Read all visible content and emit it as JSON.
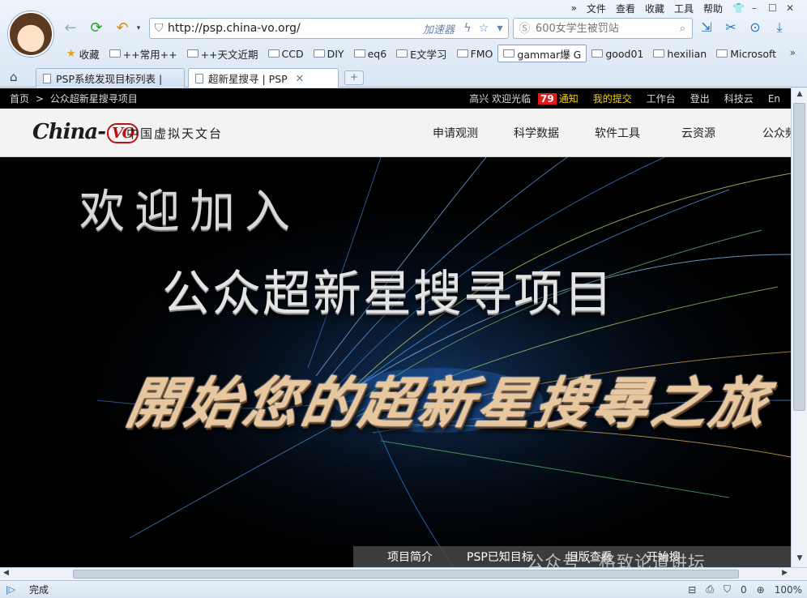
{
  "browser": {
    "menu": [
      "文件",
      "查看",
      "收藏",
      "工具",
      "帮助"
    ],
    "address_url": "http://psp.china-vo.org/",
    "accelerator_label": "加速器",
    "search_placeholder": "600女学生被罚站",
    "bookmarks": [
      {
        "label": "收藏",
        "type": "star"
      },
      {
        "label": "++常用++",
        "type": "folder"
      },
      {
        "label": "++天文近期",
        "type": "folder"
      },
      {
        "label": "CCD",
        "type": "folder"
      },
      {
        "label": "DIY",
        "type": "folder"
      },
      {
        "label": "eq6",
        "type": "folder"
      },
      {
        "label": "E文学习",
        "type": "folder"
      },
      {
        "label": "FMO",
        "type": "folder"
      },
      {
        "label": "gammar爆 G",
        "type": "folder",
        "active": true
      },
      {
        "label": "good01",
        "type": "folder"
      },
      {
        "label": "hexilian",
        "type": "folder"
      },
      {
        "label": "Microsoft",
        "type": "folder"
      }
    ],
    "tabs": [
      {
        "label": "PSP系统发现目标列表 | ",
        "active": false
      },
      {
        "label": "超新星搜寻 | PSP",
        "active": true
      }
    ]
  },
  "page": {
    "breadcrumb": {
      "home": "首页",
      "sep": ">",
      "current": "公众超新星搜寻项目"
    },
    "topbar_right": {
      "welcome": "高兴 欢迎光临",
      "notice_count": "79",
      "notice_label": "通知",
      "my_submissions": "我的提交",
      "workbench": "工作台",
      "logout": "登出",
      "kejiyun": "科技云",
      "lang": "En"
    },
    "logo_text": "China-",
    "logo_vo": "VO",
    "logo_cn": "中国虚拟天文台",
    "site_nav": [
      "申请观测",
      "科学数据",
      "软件工具",
      "云资源",
      "公众频"
    ],
    "banner": {
      "line1": "欢迎加入",
      "line2": "公众超新星搜寻项目",
      "line3": "開始您的超新星搜尋之旅"
    },
    "subnav": [
      "项目简介",
      "PSP已知目标",
      "旧版查看",
      "开始搜"
    ],
    "watermark": "公众号 · 格致论道讲坛"
  },
  "statusbar": {
    "status_text": "完成",
    "counter": "0",
    "zoom": "100%"
  }
}
